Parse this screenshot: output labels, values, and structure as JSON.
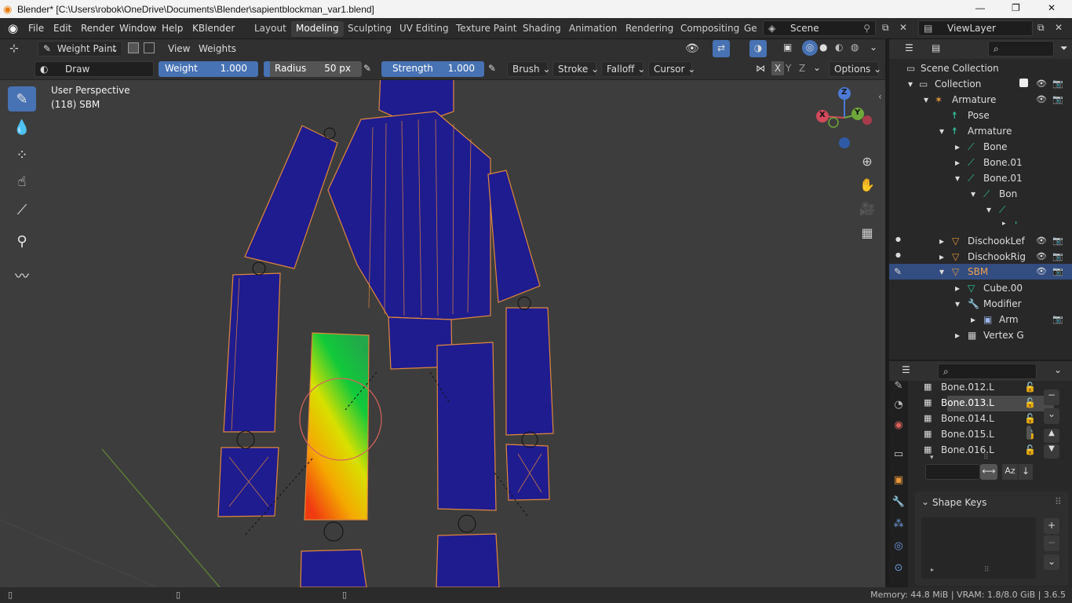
{
  "titlebar": {
    "title": "Blender* [C:\\Users\\robok\\OneDrive\\Documents\\Blender\\sapientblockman_var1.blend]",
    "minimize": "—",
    "maximize": "❐",
    "close": "✕"
  },
  "menu": {
    "items": [
      "File",
      "Edit",
      "Render",
      "Window",
      "Help",
      "KBlender"
    ]
  },
  "workspaces": [
    "Layout",
    "Modeling",
    "Sculpting",
    "UV Editing",
    "Texture Paint",
    "Shading",
    "Animation",
    "Rendering",
    "Compositing",
    "Ge"
  ],
  "active_workspace": "Modeling",
  "scene": {
    "label": "Scene",
    "viewlayer": "ViewLayer"
  },
  "header": {
    "mode": "Weight Paint",
    "view": "View",
    "weights": "Weights"
  },
  "tool_settings": {
    "brush": "Draw",
    "weight_label": "Weight",
    "weight_value": "1.000",
    "radius_label": "Radius",
    "radius_value": "50 px",
    "strength_label": "Strength",
    "strength_value": "1.000",
    "brush_menu": "Brush",
    "stroke_menu": "Stroke",
    "falloff_menu": "Falloff",
    "cursor_menu": "Cursor",
    "options_menu": "Options",
    "axes": [
      "X",
      "Y",
      "Z"
    ]
  },
  "viewport": {
    "perspective": "User Perspective",
    "object_info": "(118) SBM"
  },
  "gizmo": {
    "z": "Z",
    "y": "Y",
    "x": "X"
  },
  "outliner": {
    "rows": [
      {
        "label": "Scene Collection"
      },
      {
        "label": "Collection"
      },
      {
        "label": "Armature"
      },
      {
        "label": "Pose"
      },
      {
        "label": "Armature"
      },
      {
        "label": "Bone"
      },
      {
        "label": "Bone.01"
      },
      {
        "label": "Bone.01"
      },
      {
        "label": "Bon"
      },
      {
        "label": ""
      },
      {
        "label": ""
      },
      {
        "label": "DischookLef"
      },
      {
        "label": "DischookRig"
      },
      {
        "label": "SBM"
      },
      {
        "label": "Cube.00"
      },
      {
        "label": "Modifier"
      },
      {
        "label": "Arm"
      },
      {
        "label": "Vertex G"
      }
    ]
  },
  "vertex_groups": [
    "Bone.012.L",
    "Bone.013.L",
    "Bone.014.L",
    "Bone.015.L",
    "Bone.016.L"
  ],
  "properties": {
    "shape_keys": "Shape Keys"
  },
  "status": {
    "memory": "Memory: 44.8 MiB | VRAM: 1.8/8.0 GiB | 3.6.5"
  },
  "colors": {
    "accent": "#4772b3",
    "selection": "#334d80",
    "mesh": "#1f1c8f",
    "edge": "#e2883a"
  }
}
